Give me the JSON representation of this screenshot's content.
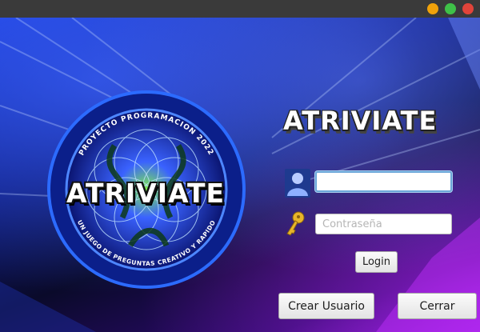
{
  "app": {
    "title": "ATRIVIATE",
    "logo_title": "ATRIVIATE",
    "logo_top_text": "PROYECTO PROGRAMACION 2022",
    "logo_bottom_text": "UN JUEGO DE PREGUNTAS CREATIVO Y RAPIDO"
  },
  "form": {
    "username_value": "",
    "password_placeholder": "Contraseña",
    "login_label": "Login",
    "create_user_label": "Crear Usuario",
    "close_label": "Cerrar"
  },
  "icons": {
    "user": "user-icon",
    "key": "key-icon"
  },
  "colors": {
    "titlebar": "#3a3a3a",
    "minimize": "#f0a20a",
    "maximize": "#3fc148",
    "close": "#e0443a",
    "focus_border": "#6aa6d8"
  }
}
